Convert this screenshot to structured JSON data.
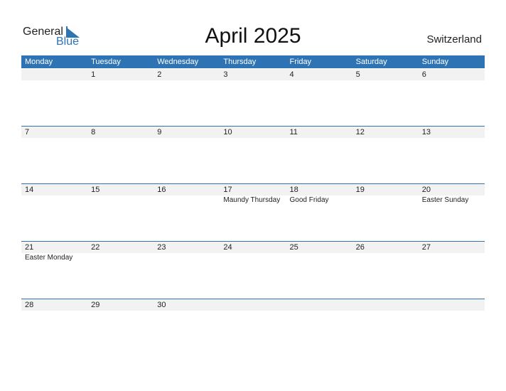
{
  "logo": {
    "general": "General",
    "blue": "Blue"
  },
  "title": "April 2025",
  "country": "Switzerland",
  "colors": {
    "accent": "#2e74b5",
    "row_bg": "#f2f2f2"
  },
  "weekdays": [
    "Monday",
    "Tuesday",
    "Wednesday",
    "Thursday",
    "Friday",
    "Saturday",
    "Sunday"
  ],
  "weeks": [
    {
      "days": [
        "",
        "1",
        "2",
        "3",
        "4",
        "5",
        "6"
      ],
      "holidays": [
        "",
        "",
        "",
        "",
        "",
        "",
        ""
      ]
    },
    {
      "days": [
        "7",
        "8",
        "9",
        "10",
        "11",
        "12",
        "13"
      ],
      "holidays": [
        "",
        "",
        "",
        "",
        "",
        "",
        ""
      ]
    },
    {
      "days": [
        "14",
        "15",
        "16",
        "17",
        "18",
        "19",
        "20"
      ],
      "holidays": [
        "",
        "",
        "",
        "Maundy Thursday",
        "Good Friday",
        "",
        "Easter Sunday"
      ]
    },
    {
      "days": [
        "21",
        "22",
        "23",
        "24",
        "25",
        "26",
        "27"
      ],
      "holidays": [
        "Easter Monday",
        "",
        "",
        "",
        "",
        "",
        ""
      ]
    },
    {
      "days": [
        "28",
        "29",
        "30",
        "",
        "",
        "",
        ""
      ],
      "holidays": [
        "",
        "",
        "",
        "",
        "",
        "",
        ""
      ]
    }
  ]
}
